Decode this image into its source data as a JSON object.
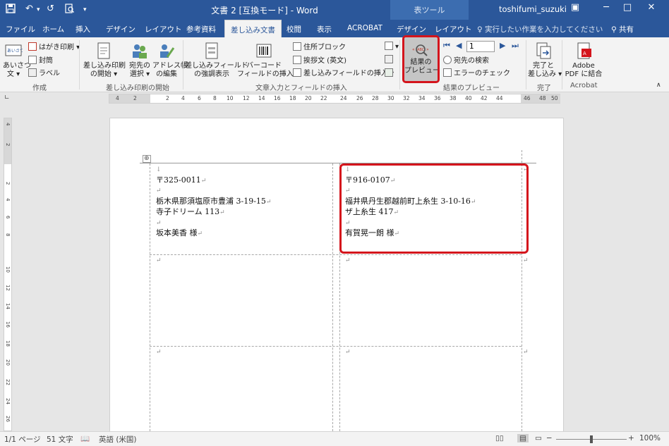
{
  "titlebar": {
    "title": "文書 2 [互換モード] - Word",
    "context_group": "表ツール",
    "user": "toshifumi_suzuki",
    "minimize": "─",
    "restore": "□",
    "close": "✕",
    "ribbon_opts": "▣"
  },
  "tabs": [
    {
      "label": "ファイル"
    },
    {
      "label": "ホーム"
    },
    {
      "label": "挿入"
    },
    {
      "label": "デザイン"
    },
    {
      "label": "レイアウト"
    },
    {
      "label": "参考資料"
    },
    {
      "label": "差し込み文書"
    },
    {
      "label": "校閲"
    },
    {
      "label": "表示"
    },
    {
      "label": "ACROBAT"
    },
    {
      "label": "デザイン"
    },
    {
      "label": "レイアウト"
    }
  ],
  "tell_me": "実行したい作業を入力してください",
  "share": "共有",
  "ribbon": {
    "create": {
      "greeting_l1": "あいさつ",
      "greeting_l2": "文 ▾",
      "postcard": "はがき印刷 ▾",
      "envelope": "封筒",
      "label": "ラベル",
      "group": "作成"
    },
    "start_merge": {
      "start_l1": "差し込み印刷",
      "start_l2": "の開始 ▾",
      "select_l1": "宛先の",
      "select_l2": "選択 ▾",
      "edit_l1": "アドレス帳",
      "edit_l2": "の編集",
      "group": "差し込み印刷の開始"
    },
    "fields": {
      "highlight_l1": "差し込みフィールド",
      "highlight_l2": "の強調表示",
      "barcode_l1": "バーコード",
      "barcode_l2": "フィールドの挿入 ▾",
      "address_block": "住所ブロック",
      "greeting_line": "挨拶文 (英文)",
      "insert_field": "差し込みフィールドの挿入 ▾",
      "group": "文章入力とフィールドの挿入"
    },
    "preview": {
      "preview_l1": "結果の",
      "preview_l2": "プレビュー",
      "record": "1",
      "find": "宛先の検索",
      "check": "エラーのチェック",
      "group": "結果のプレビュー"
    },
    "finish": {
      "finish_l1": "完了と",
      "finish_l2": "差し込み ▾",
      "group": "完了"
    },
    "acrobat": {
      "pdf_l1": "Adobe",
      "pdf_l2": "PDF に結合",
      "group": "Acrobat"
    }
  },
  "ruler_h": [
    "4",
    "2",
    "2",
    "4",
    "6",
    "8",
    "10",
    "12",
    "14",
    "16",
    "18",
    "20",
    "22",
    "24",
    "26",
    "28",
    "30",
    "32",
    "34",
    "36",
    "38",
    "40",
    "42",
    "44",
    "46",
    "48",
    "50"
  ],
  "ruler_v": [
    "4",
    "2",
    "2",
    "4",
    "6",
    "8",
    "10",
    "12",
    "14",
    "16",
    "18",
    "20",
    "22",
    "24",
    "26"
  ],
  "document": {
    "label1": {
      "postal": "〒325-0011",
      "address1": "栃木県那須塩原市豊浦 3-19-15",
      "address2": "寺子ドリーム 113",
      "name": "坂本美香  様"
    },
    "label2": {
      "postal": "〒916-0107",
      "address1": "福井県丹生郡越前町上糸生 3-10-16",
      "address2": "ザ上糸生 417",
      "name": "有賀晃一朗  様"
    },
    "para_mark": "↵",
    "anchor_mark": "↓",
    "move_handle": "⊕"
  },
  "statusbar": {
    "page": "1/1 ページ",
    "words": "51 文字",
    "lang": "英語 (米国)",
    "zoom": "100%",
    "minus": "─",
    "plus": "+"
  }
}
